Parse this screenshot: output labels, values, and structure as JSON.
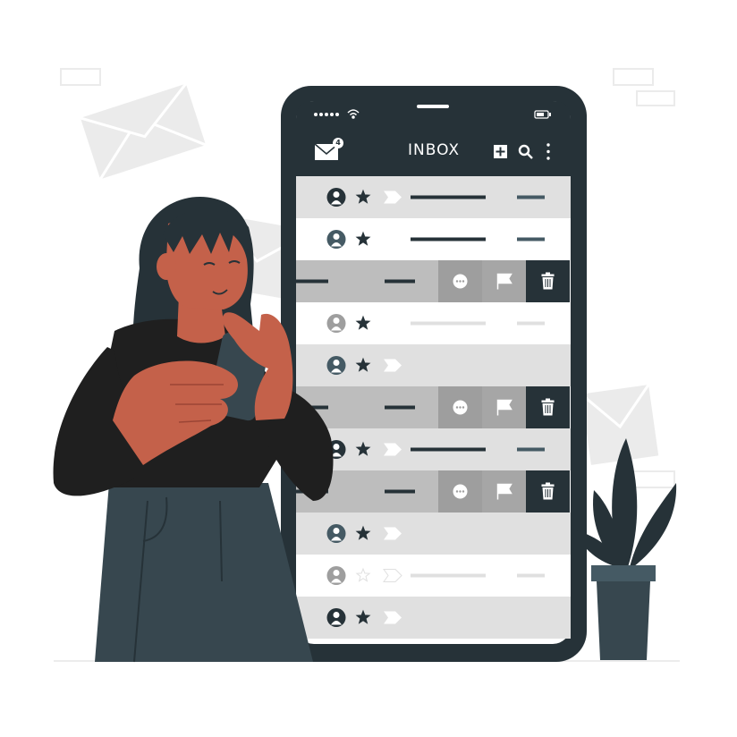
{
  "header": {
    "title": "INBOX",
    "badge_count": "4",
    "icons": [
      "mail-icon",
      "compose-icon",
      "search-icon",
      "more-vert-icon"
    ]
  },
  "status_bar": {
    "icons": [
      "signal-dots-icon",
      "wifi-icon",
      "battery-icon"
    ]
  },
  "email_rows": [
    {
      "kind": "email",
      "avatar": "dark",
      "starred": true,
      "read": false
    },
    {
      "kind": "email",
      "avatar": "slate",
      "starred": true,
      "read": false
    },
    {
      "kind": "swiped",
      "actions": [
        "more-icon",
        "flag-icon",
        "trash-icon"
      ]
    },
    {
      "kind": "email",
      "avatar": "gray",
      "starred": true,
      "read": true
    },
    {
      "kind": "email",
      "avatar": "slate",
      "starred": true,
      "read": true
    },
    {
      "kind": "swiped",
      "actions": [
        "more-icon",
        "flag-icon",
        "trash-icon"
      ]
    },
    {
      "kind": "email",
      "avatar": "dark",
      "starred": true,
      "read": false
    },
    {
      "kind": "swiped",
      "actions": [
        "more-icon",
        "flag-icon",
        "trash-icon"
      ]
    },
    {
      "kind": "email",
      "avatar": "slate",
      "starred": true,
      "read": true
    },
    {
      "kind": "email",
      "avatar": "gray",
      "starred": false,
      "read": true
    },
    {
      "kind": "email",
      "avatar": "dark",
      "starred": true,
      "read": true
    }
  ],
  "colors": {
    "phone_frame": "#263238",
    "header": "#263238",
    "row_light": "#e0e0e0",
    "row_white": "#ffffff",
    "swipe_bg": "#bdbdbd",
    "action_gray": "#9e9e9e",
    "action_mid": "#a6a6a6",
    "action_dark": "#263238",
    "skin": "#c4614a",
    "hair": "#263238",
    "shirt": "#1f1f1f",
    "pants": "#37474f",
    "plant_pot": "#455a64",
    "envelope_bg": "#ebebeb"
  }
}
